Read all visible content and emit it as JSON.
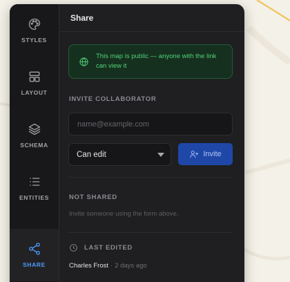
{
  "panel": {
    "title": "Share"
  },
  "rail": {
    "items": [
      {
        "label": "STYLES",
        "icon": "palette-icon"
      },
      {
        "label": "LAYOUT",
        "icon": "layout-icon"
      },
      {
        "label": "SCHEMA",
        "icon": "layers-icon"
      },
      {
        "label": "ENTITIES",
        "icon": "list-icon"
      },
      {
        "label": "SHARE",
        "icon": "share-icon",
        "active": true
      }
    ]
  },
  "notice": {
    "text": "This map is public — anyone with the link can view it",
    "icon": "globe-icon"
  },
  "invite": {
    "heading": "INVITE COLLABORATOR",
    "email_placeholder": "name@example.com",
    "email_value": "",
    "role_selected": "Can edit",
    "button_label": "Invite",
    "button_icon": "user-plus-icon"
  },
  "shared": {
    "heading": "NOT SHARED",
    "empty_text": "Invite someone using the form above."
  },
  "last_edited": {
    "heading": "LAST EDITED",
    "icon": "clock-icon",
    "editor": "Charles Frost",
    "separator": "·",
    "time": "2 days ago"
  },
  "colors": {
    "panel_bg": "#1f1f21",
    "rail_bg": "#18181a",
    "accent": "#4d9bff",
    "notice_green": "#4fd27a",
    "button_blue": "#1e47a8"
  }
}
